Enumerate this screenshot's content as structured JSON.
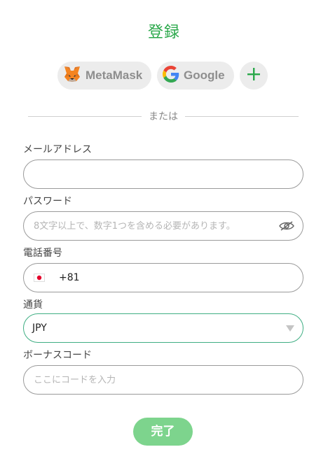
{
  "title": "登録",
  "social": {
    "metamask_label": "MetaMask",
    "google_label": "Google"
  },
  "divider_text": "または",
  "email": {
    "label": "メールアドレス",
    "value": "",
    "placeholder": ""
  },
  "password": {
    "label": "パスワード",
    "placeholder": "8文字以上で、数字1つを含める必要があります。"
  },
  "phone": {
    "label": "電話番号",
    "country_code": "+81",
    "flag_icon": "japan-flag-icon"
  },
  "currency": {
    "label": "通貨",
    "value": "JPY"
  },
  "bonus": {
    "label": "ボーナスコード",
    "placeholder": "ここにコードを入力"
  },
  "submit_label": "完了",
  "colors": {
    "accent": "#2aa84a",
    "submit_bg": "#7dd48d",
    "focus_border": "#3fae83"
  }
}
